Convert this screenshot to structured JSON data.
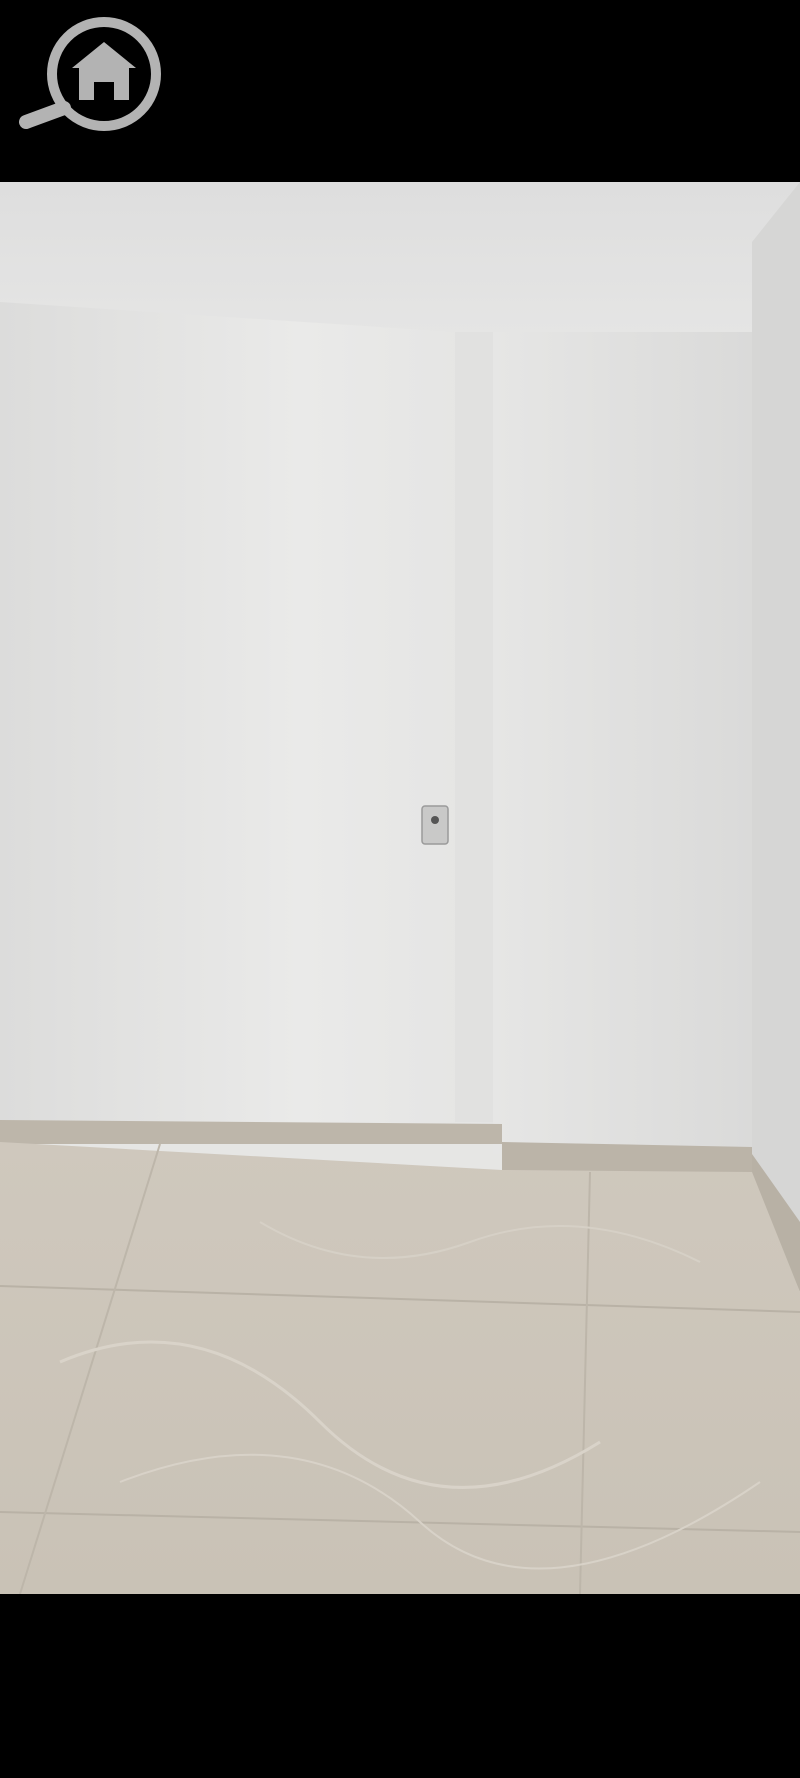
{
  "app": {
    "logo_icon": "home-search-icon",
    "logo_color": "#b3b3b3"
  },
  "viewer": {
    "content_type": "photo",
    "subject_icon": "empty-room-photo",
    "background_color": "#000000"
  }
}
